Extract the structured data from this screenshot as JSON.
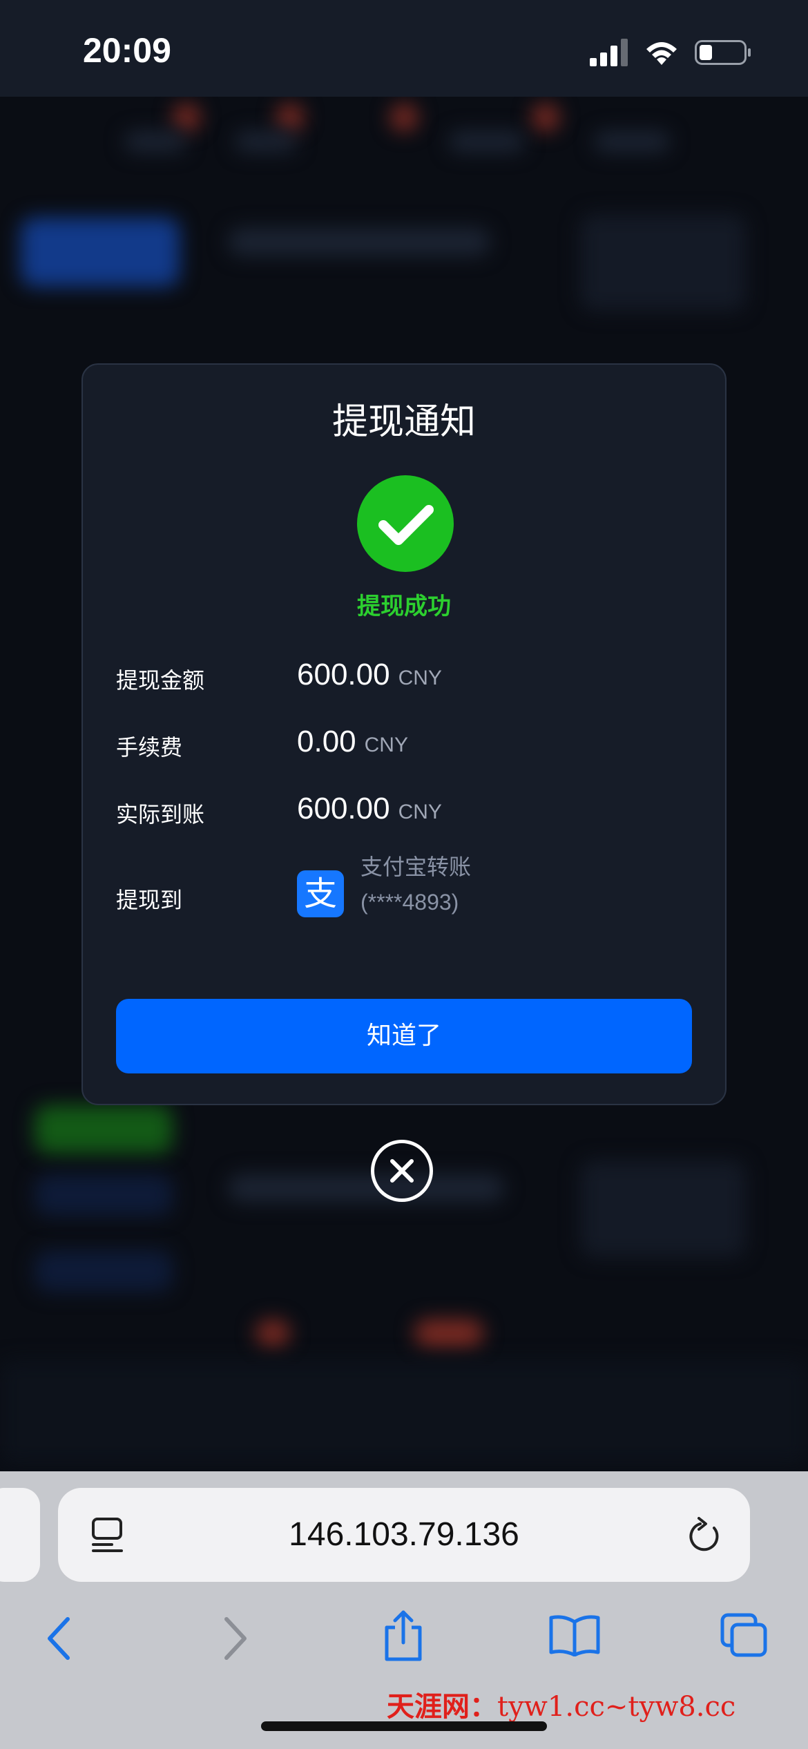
{
  "status_bar": {
    "time": "20:09"
  },
  "modal": {
    "title": "提现通知",
    "status_text": "提现成功",
    "rows": [
      {
        "label": "提现金额",
        "amount": "600.00",
        "currency": "CNY"
      },
      {
        "label": "手续费",
        "amount": "0.00",
        "currency": "CNY"
      },
      {
        "label": "实际到账",
        "amount": "600.00",
        "currency": "CNY"
      }
    ],
    "destination": {
      "label": "提现到",
      "method_name": "支付宝转账",
      "account": "(****4893)",
      "icon_glyph": "支"
    },
    "confirm_label": "知道了"
  },
  "browser": {
    "url": "146.103.79.136"
  },
  "watermark": {
    "site_name": "天涯网：",
    "domains": "tyw1.cc~tyw8.cc"
  },
  "colors": {
    "accent": "#0066ff",
    "success": "#1bbf21",
    "alipay": "#1677ff"
  }
}
